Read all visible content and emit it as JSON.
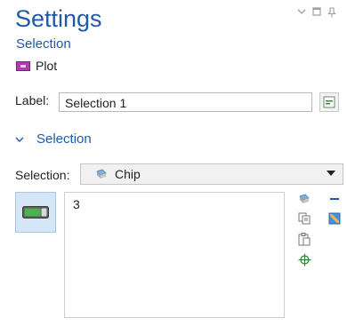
{
  "header": {
    "title": "Settings",
    "subtitle": "Selection",
    "node_label": "Plot",
    "window_controls": [
      "chevron-down-icon",
      "maximize-icon",
      "pin-icon"
    ]
  },
  "label_field": {
    "label": "Label:",
    "value": "Selection 1"
  },
  "section": {
    "title": "Selection",
    "expanded": true
  },
  "selection": {
    "label": "Selection:",
    "selected": "Chip",
    "list_items": [
      "3"
    ],
    "side_tools_left": [
      "select-icon",
      "copy-icon",
      "paste-icon",
      "zoom-extents-icon"
    ],
    "side_tools_right": [
      "remove-icon",
      "clear-selection-icon"
    ]
  },
  "colors": {
    "accent": "#1f5aa8",
    "plot_icon": "#b03bb0",
    "toggle_active_bg": "#d5e6f7"
  }
}
